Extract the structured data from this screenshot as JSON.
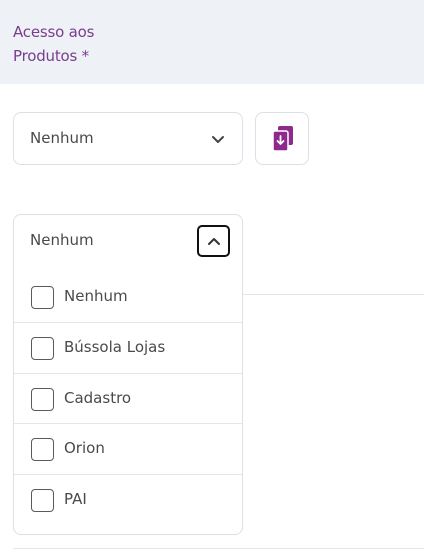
{
  "header": {
    "field_label": "Acesso aos Produtos *"
  },
  "select_closed": {
    "value": "Nenhum",
    "icon": "chevron-down-icon"
  },
  "copy_button": {
    "icon": "document-download-icon",
    "accent": "#8e2a8b"
  },
  "dropdown": {
    "value": "Nenhum",
    "toggle_icon": "chevron-up-icon",
    "options": [
      {
        "label": "Nenhum",
        "checked": false
      },
      {
        "label": "Bússola Lojas",
        "checked": false
      },
      {
        "label": "Cadastro",
        "checked": false
      },
      {
        "label": "Orion",
        "checked": false
      },
      {
        "label": "PAI",
        "checked": false
      }
    ]
  }
}
